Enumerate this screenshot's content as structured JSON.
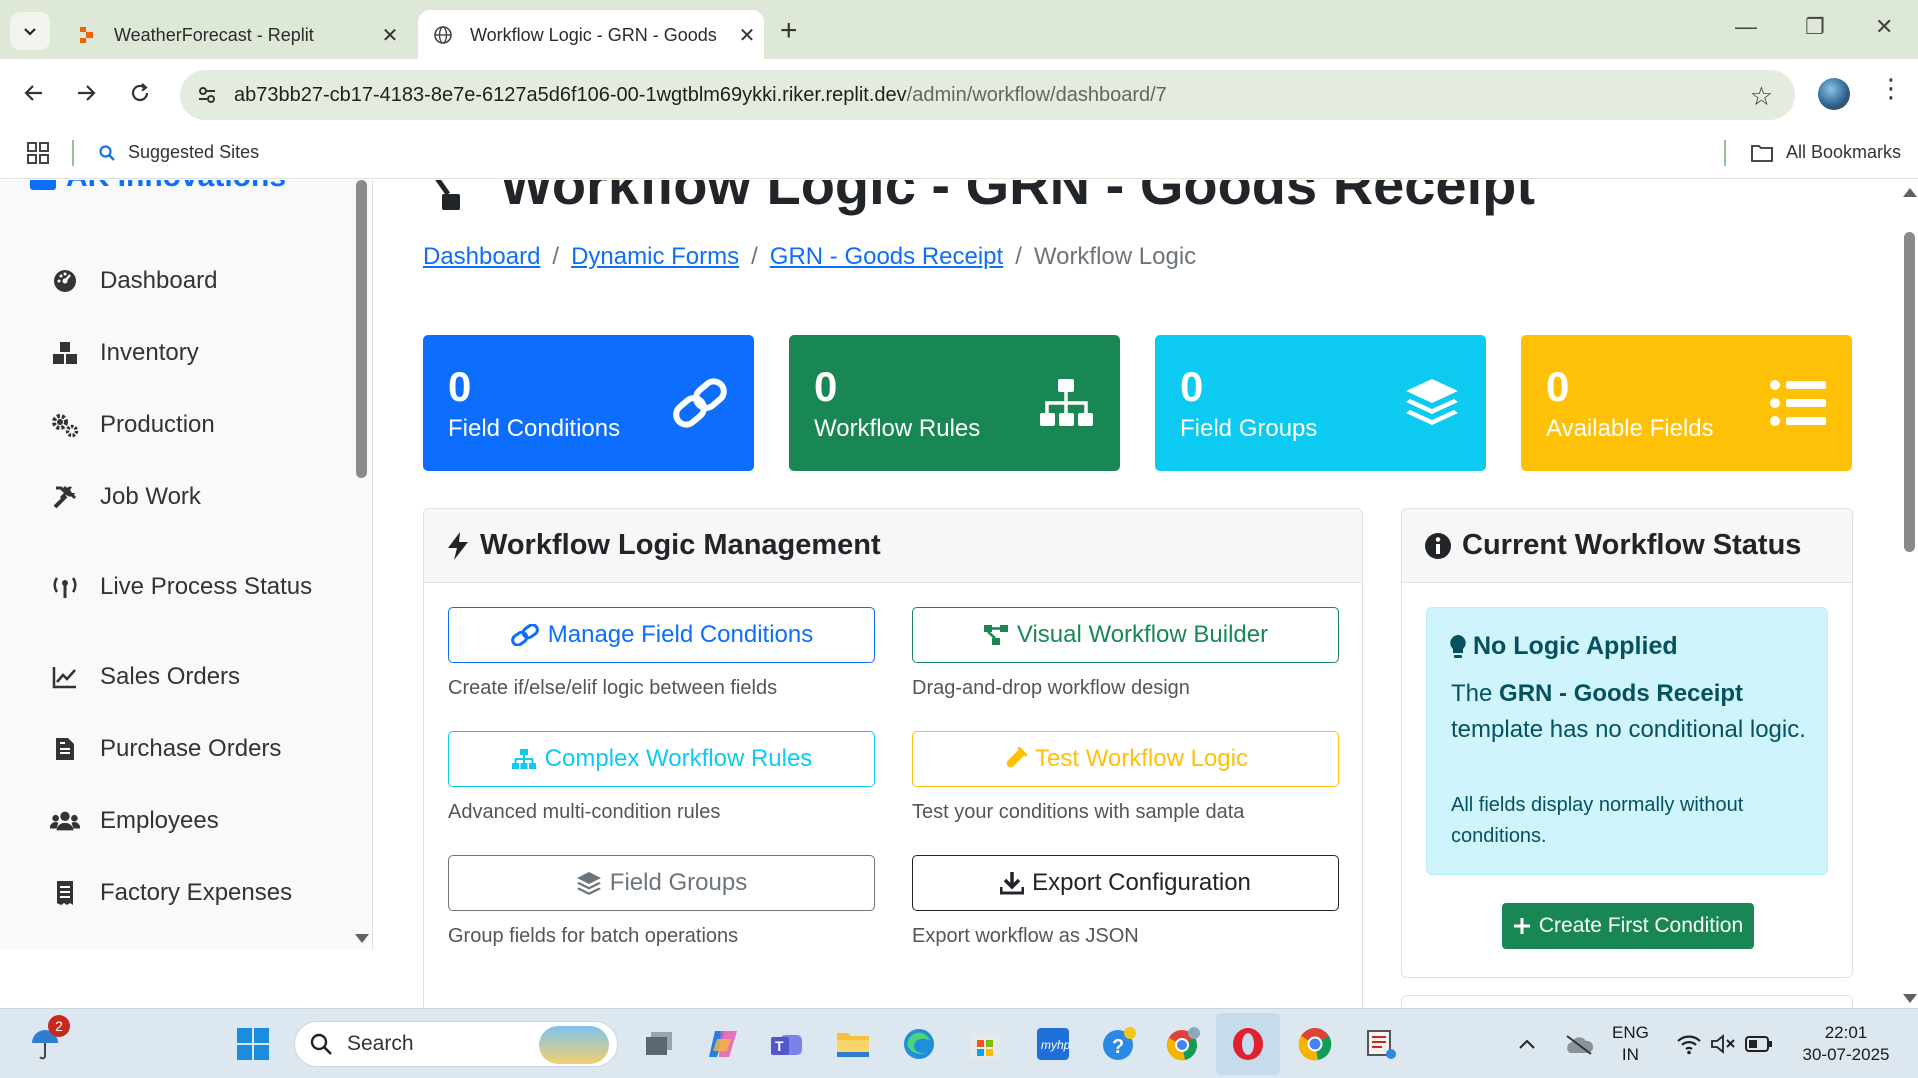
{
  "browser": {
    "tabs": [
      {
        "title": "WeatherForecast - Replit",
        "active": false
      },
      {
        "title": "Workflow Logic - GRN - Goods",
        "active": true
      }
    ],
    "url_host": "ab73bb27-cb17-4183-8e7e-6127a5d6f106-00-1wgtblm69ykki.riker.replit.dev",
    "url_path": "/admin/workflow/dashboard/7",
    "bookmarks": {
      "suggested": "Suggested Sites",
      "all": "All Bookmarks"
    }
  },
  "sidebar": {
    "brand": "AK Innovations",
    "items": [
      {
        "label": "Dashboard",
        "icon": "gauge-icon"
      },
      {
        "label": "Inventory",
        "icon": "boxes-icon"
      },
      {
        "label": "Production",
        "icon": "cogs-icon"
      },
      {
        "label": "Job Work",
        "icon": "tools-icon"
      },
      {
        "label": "Live Process Status",
        "icon": "broadcast-icon"
      },
      {
        "label": "Sales Orders",
        "icon": "chart-line-icon"
      },
      {
        "label": "Purchase Orders",
        "icon": "file-invoice-icon"
      },
      {
        "label": "Employees",
        "icon": "users-icon"
      },
      {
        "label": "Factory Expenses",
        "icon": "receipt-icon"
      }
    ]
  },
  "page": {
    "title": "Workflow Logic - GRN - Goods Receipt",
    "breadcrumb": [
      "Dashboard",
      "Dynamic Forms",
      "GRN - Goods Receipt",
      "Workflow Logic"
    ]
  },
  "stats": [
    {
      "value": "0",
      "label": "Field Conditions",
      "color": "#0d6efd",
      "icon": "link-icon"
    },
    {
      "value": "0",
      "label": "Workflow Rules",
      "color": "#198754",
      "icon": "sitemap-icon"
    },
    {
      "value": "0",
      "label": "Field Groups",
      "color": "#0dcaf0",
      "icon": "layers-icon"
    },
    {
      "value": "0",
      "label": "Available Fields",
      "color": "#ffc107",
      "icon": "list-icon"
    }
  ],
  "management": {
    "title": "Workflow Logic Management",
    "actions": [
      {
        "label": "Manage Field Conditions",
        "desc": "Create if/else/elif logic between fields",
        "color": "#0d6efd"
      },
      {
        "label": "Visual Workflow Builder",
        "desc": "Drag-and-drop workflow design",
        "color": "#198754"
      },
      {
        "label": "Complex Workflow Rules",
        "desc": "Advanced multi-condition rules",
        "color": "#0dcaf0"
      },
      {
        "label": "Test Workflow Logic",
        "desc": "Test your conditions with sample data",
        "color": "#ffc107"
      },
      {
        "label": "Field Groups",
        "desc": "Group fields for batch operations",
        "color": "#6c757d"
      },
      {
        "label": "Export Configuration",
        "desc": "Export workflow as JSON",
        "color": "#212529"
      }
    ]
  },
  "status": {
    "title": "Current Workflow Status",
    "alert_title": "No Logic Applied",
    "text_pre": "The",
    "template": "GRN - Goods Receipt",
    "text_post": "template has no conditional logic.",
    "small": "All fields display normally without conditions.",
    "button": "Create First Condition"
  },
  "taskbar": {
    "notification_count": "2",
    "search": "Search",
    "lang": "ENG",
    "region": "IN",
    "time": "22:01",
    "date": "30-07-2025"
  }
}
